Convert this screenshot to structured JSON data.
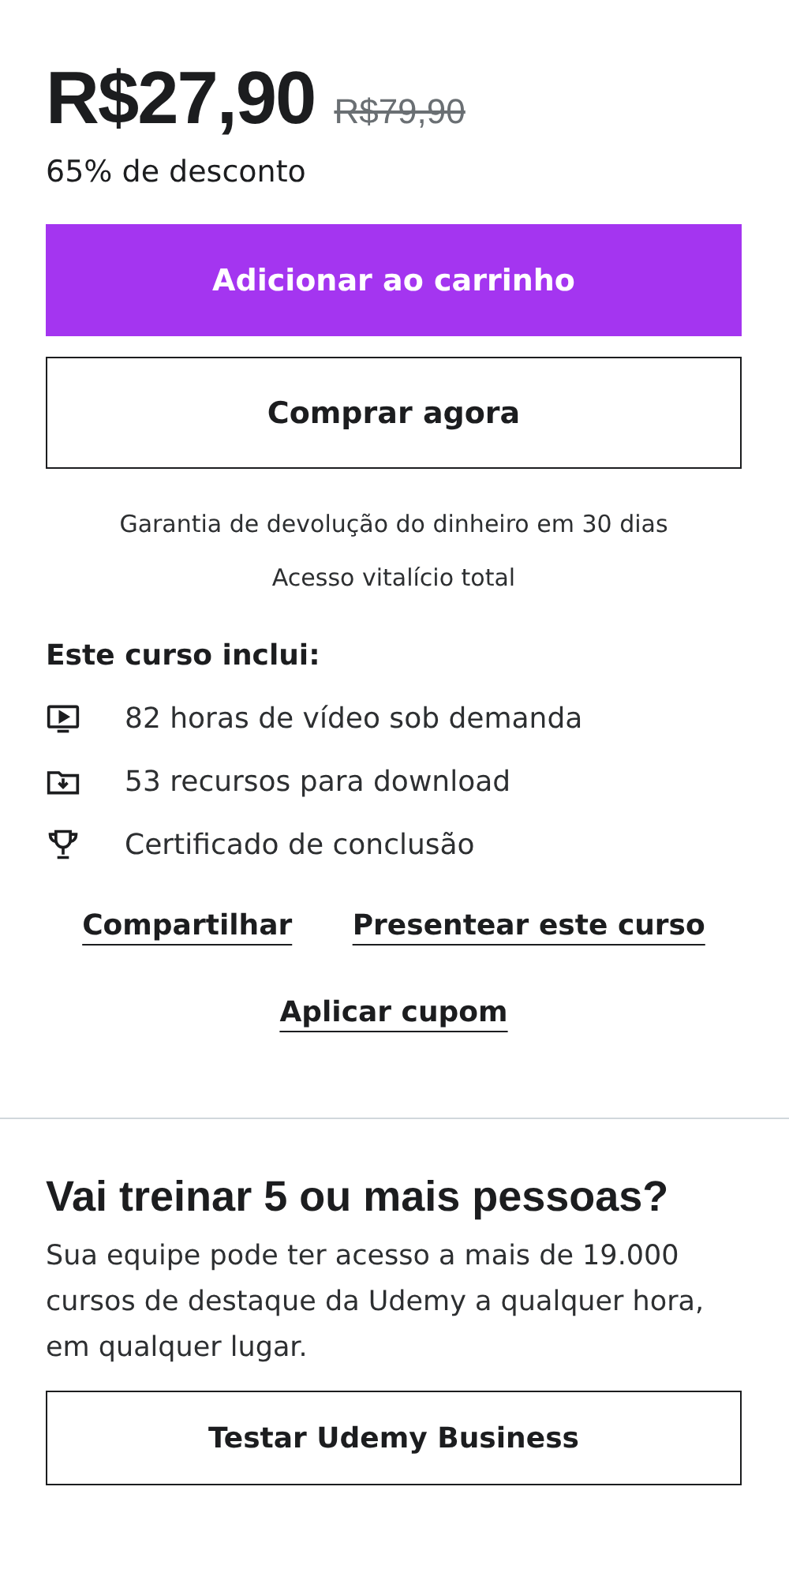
{
  "price": {
    "current": "R$27,90",
    "original": "R$79,90",
    "discount": "65% de desconto"
  },
  "buttons": [
    {
      "label": "Adicionar ao carrinho",
      "kind": "primary"
    },
    {
      "label": "Comprar agora",
      "kind": "outline"
    }
  ],
  "guarantees": [
    "Garantia de devolução do dinheiro em 30 dias",
    "Acesso vitalício total"
  ],
  "includes": {
    "title": "Este curso inclui:",
    "items": [
      {
        "kind": "video",
        "text": "82 horas de vídeo sob demanda"
      },
      {
        "kind": "download",
        "text": "53 recursos para download"
      },
      {
        "kind": "certificate",
        "text": "Certificado de conclusão"
      }
    ]
  },
  "links": [
    "Compartilhar",
    "Presentear este curso"
  ],
  "coupon_link": "Aplicar cupom",
  "business": {
    "title": "Vai treinar 5 ou mais pessoas?",
    "text": "Sua equipe pode ter acesso a mais de 19.000 cursos de destaque da Udemy a qualquer hora, em qualquer lugar.",
    "button": "Testar Udemy Business"
  }
}
